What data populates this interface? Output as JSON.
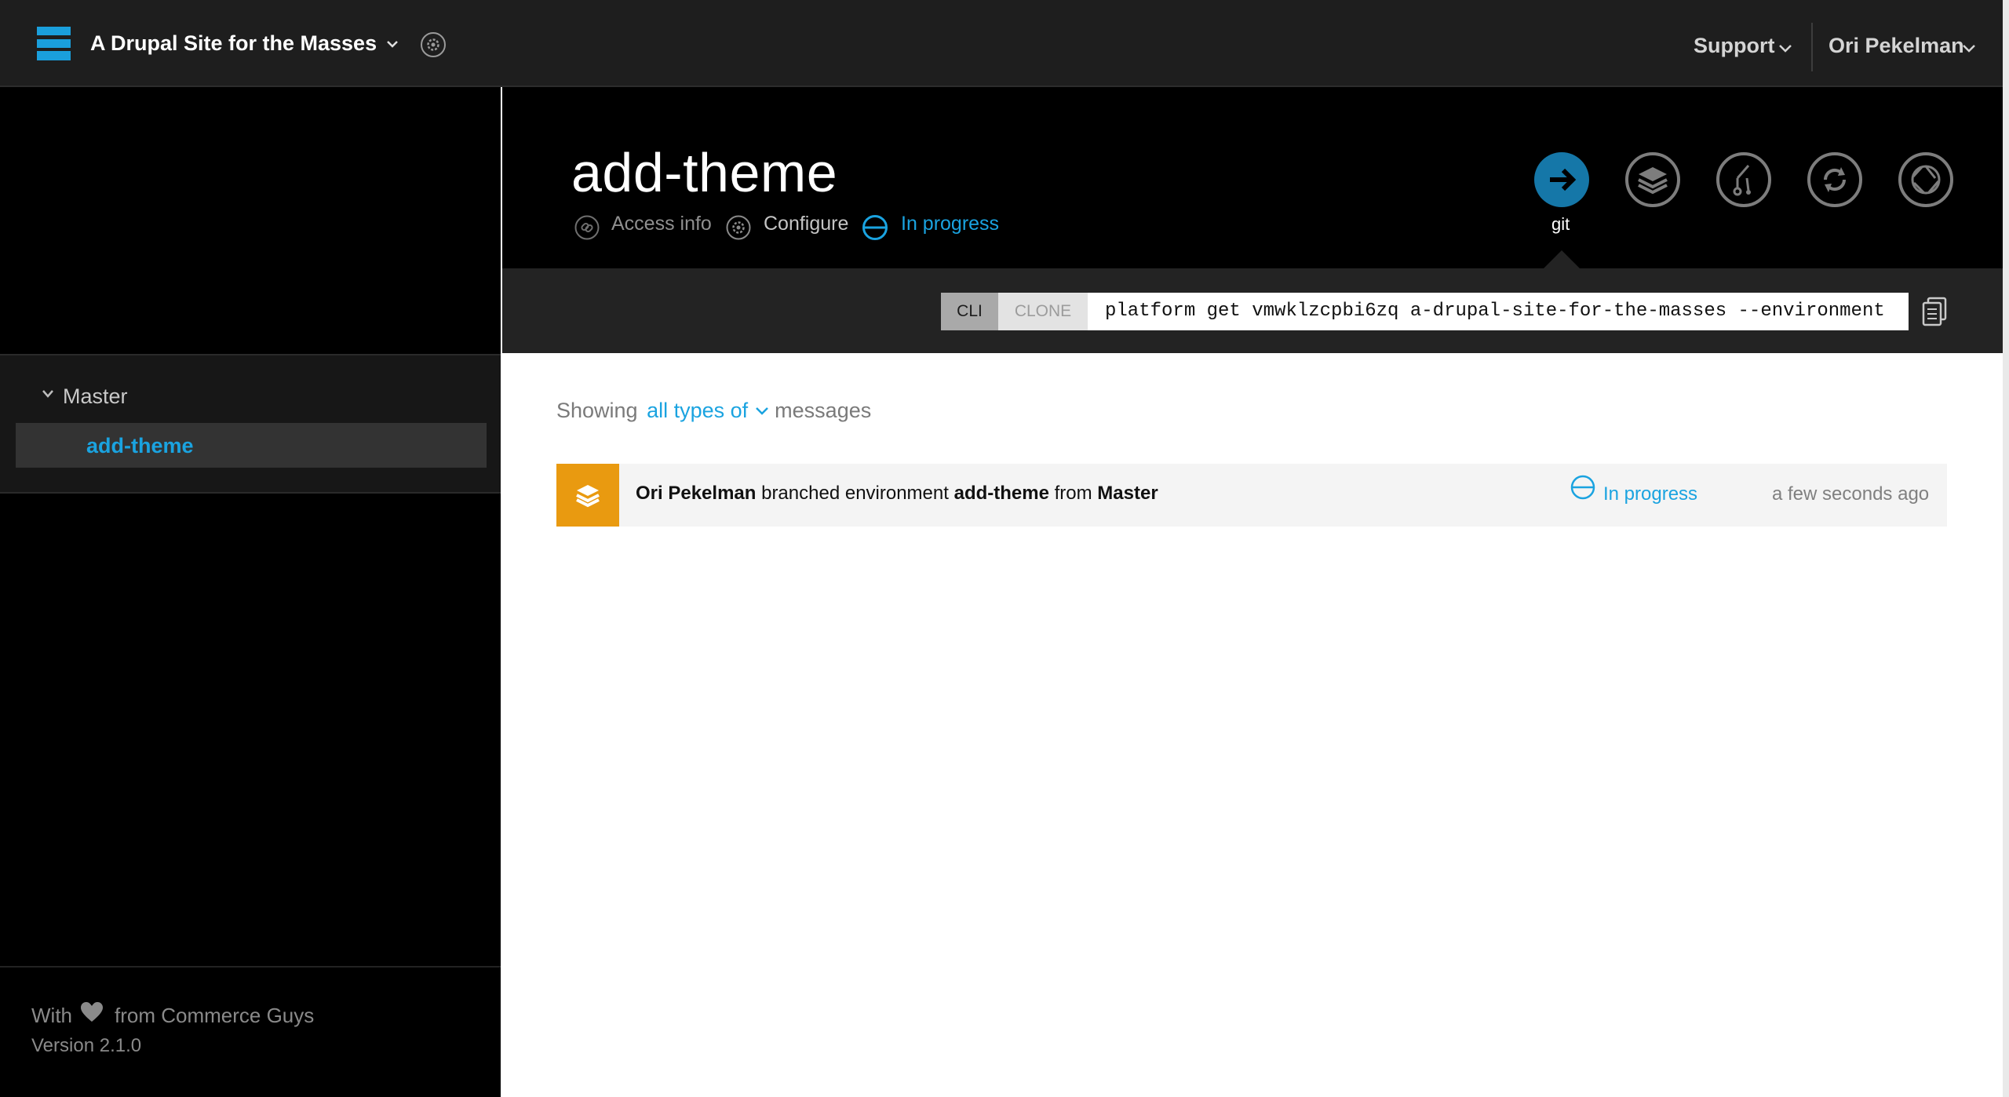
{
  "header": {
    "project_title": "A Drupal Site for the Masses",
    "support_label": "Support",
    "user_label": "Ori Pekelman"
  },
  "sidebar": {
    "branches": [
      {
        "label": "Master",
        "expanded": true
      },
      {
        "label": "add-theme",
        "active": true
      }
    ],
    "footer": {
      "with_text": "With",
      "from_text": "from Commerce Guys",
      "version": "Version 2.1.0"
    }
  },
  "environment": {
    "title": "add-theme",
    "links": {
      "access_info": "Access info",
      "configure": "Configure",
      "status": "In progress"
    },
    "actions": [
      {
        "name": "git",
        "label": "git",
        "icon": "arrow-right-icon",
        "active": true
      },
      {
        "name": "branch",
        "icon": "layers-icon"
      },
      {
        "name": "merge",
        "icon": "merge-icon"
      },
      {
        "name": "sync",
        "icon": "sync-icon"
      },
      {
        "name": "snapshot",
        "icon": "aperture-icon"
      }
    ],
    "cli": {
      "cli_tab": "CLI",
      "clone_tab": "CLONE",
      "command": "platform get vmwklzcpbi6zq a-drupal-site-for-the-masses --environment"
    }
  },
  "activity": {
    "filter": {
      "showing": "Showing",
      "types": "all types of",
      "messages": "messages"
    },
    "items": [
      {
        "user": "Ori Pekelman",
        "action": "branched environment",
        "environment": "add-theme",
        "from_word": "from",
        "parent": "Master",
        "status": "In progress",
        "time": "a few seconds ago"
      }
    ]
  },
  "colors": {
    "accent": "#1aa3e0",
    "activity_icon": "#e99a10",
    "header_bg": "#1e1e1e",
    "sidebar_bg": "#000000"
  }
}
